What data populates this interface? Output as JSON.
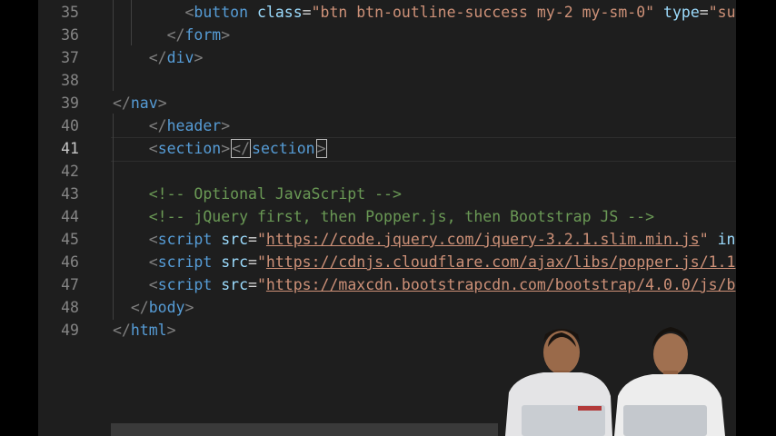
{
  "editor": {
    "lines": [
      {
        "num": "35",
        "segments": [
          {
            "t": "        ",
            "c": "eq"
          },
          {
            "t": "<",
            "c": "punc"
          },
          {
            "t": "button",
            "c": "tag"
          },
          {
            "t": " ",
            "c": "eq"
          },
          {
            "t": "class",
            "c": "attr"
          },
          {
            "t": "=",
            "c": "eq"
          },
          {
            "t": "\"btn btn-outline-success my-2 my-sm-0\"",
            "c": "str"
          },
          {
            "t": " ",
            "c": "eq"
          },
          {
            "t": "type",
            "c": "attr"
          },
          {
            "t": "=",
            "c": "eq"
          },
          {
            "t": "\"subm",
            "c": "str"
          }
        ]
      },
      {
        "num": "36",
        "segments": [
          {
            "t": "      ",
            "c": "eq"
          },
          {
            "t": "</",
            "c": "punc"
          },
          {
            "t": "form",
            "c": "tag"
          },
          {
            "t": ">",
            "c": "punc"
          }
        ]
      },
      {
        "num": "37",
        "segments": [
          {
            "t": "    ",
            "c": "eq"
          },
          {
            "t": "</",
            "c": "punc"
          },
          {
            "t": "div",
            "c": "tag"
          },
          {
            "t": ">",
            "c": "punc"
          }
        ]
      },
      {
        "num": "38",
        "segments": []
      },
      {
        "num": "39",
        "segments": [
          {
            "t": "</",
            "c": "punc"
          },
          {
            "t": "nav",
            "c": "tag"
          },
          {
            "t": ">",
            "c": "punc"
          }
        ]
      },
      {
        "num": "40",
        "segments": [
          {
            "t": "    ",
            "c": "eq"
          },
          {
            "t": "</",
            "c": "punc"
          },
          {
            "t": "header",
            "c": "tag"
          },
          {
            "t": ">",
            "c": "punc"
          }
        ]
      },
      {
        "num": "41",
        "active": true,
        "segments": [
          {
            "t": "    ",
            "c": "eq"
          },
          {
            "t": "<",
            "c": "punc"
          },
          {
            "t": "section",
            "c": "tag"
          },
          {
            "t": ">",
            "c": "punc"
          },
          {
            "t": "</",
            "c": "punc",
            "box": true
          },
          {
            "t": "section",
            "c": "tag"
          },
          {
            "t": ">",
            "c": "punc",
            "box": true
          }
        ]
      },
      {
        "num": "42",
        "segments": []
      },
      {
        "num": "43",
        "segments": [
          {
            "t": "    ",
            "c": "eq"
          },
          {
            "t": "<!-- Optional JavaScript -->",
            "c": "cmt"
          }
        ]
      },
      {
        "num": "44",
        "segments": [
          {
            "t": "    ",
            "c": "eq"
          },
          {
            "t": "<!-- jQuery first, then Popper.js, then Bootstrap JS -->",
            "c": "cmt"
          }
        ]
      },
      {
        "num": "45",
        "segments": [
          {
            "t": "    ",
            "c": "eq"
          },
          {
            "t": "<",
            "c": "punc"
          },
          {
            "t": "script",
            "c": "tag"
          },
          {
            "t": " ",
            "c": "eq"
          },
          {
            "t": "src",
            "c": "attr"
          },
          {
            "t": "=",
            "c": "eq"
          },
          {
            "t": "\"",
            "c": "str"
          },
          {
            "t": "https://code.jquery.com/jquery-3.2.1.slim.min.js",
            "c": "url"
          },
          {
            "t": "\"",
            "c": "str"
          },
          {
            "t": " ",
            "c": "eq"
          },
          {
            "t": "in",
            "c": "attr"
          }
        ]
      },
      {
        "num": "46",
        "segments": [
          {
            "t": "    ",
            "c": "eq"
          },
          {
            "t": "<",
            "c": "punc"
          },
          {
            "t": "script",
            "c": "tag"
          },
          {
            "t": " ",
            "c": "eq"
          },
          {
            "t": "src",
            "c": "attr"
          },
          {
            "t": "=",
            "c": "eq"
          },
          {
            "t": "\"",
            "c": "str"
          },
          {
            "t": "https://cdnjs.cloudflare.com/ajax/libs/popper.js/1.1",
            "c": "url"
          }
        ]
      },
      {
        "num": "47",
        "segments": [
          {
            "t": "    ",
            "c": "eq"
          },
          {
            "t": "<",
            "c": "punc"
          },
          {
            "t": "script",
            "c": "tag"
          },
          {
            "t": " ",
            "c": "eq"
          },
          {
            "t": "src",
            "c": "attr"
          },
          {
            "t": "=",
            "c": "eq"
          },
          {
            "t": "\"",
            "c": "str"
          },
          {
            "t": "https://maxcdn.bootstrapcdn.com/bootstrap/4.0.0/js/b",
            "c": "url"
          }
        ]
      },
      {
        "num": "48",
        "segments": [
          {
            "t": "  ",
            "c": "eq"
          },
          {
            "t": "</",
            "c": "punc"
          },
          {
            "t": "body",
            "c": "tag"
          },
          {
            "t": ">",
            "c": "punc"
          }
        ]
      },
      {
        "num": "49",
        "segments": [
          {
            "t": "</",
            "c": "punc"
          },
          {
            "t": "html",
            "c": "tag"
          },
          {
            "t": ">",
            "c": "punc"
          }
        ]
      }
    ]
  },
  "theme": {
    "background": "#1e1e1e",
    "tag": "#569cd6",
    "attribute": "#9cdcfe",
    "string": "#ce9178",
    "comment": "#6a9955",
    "line_number": "#858585"
  },
  "overlay": {
    "icon": "webcam-presenters-icon"
  }
}
